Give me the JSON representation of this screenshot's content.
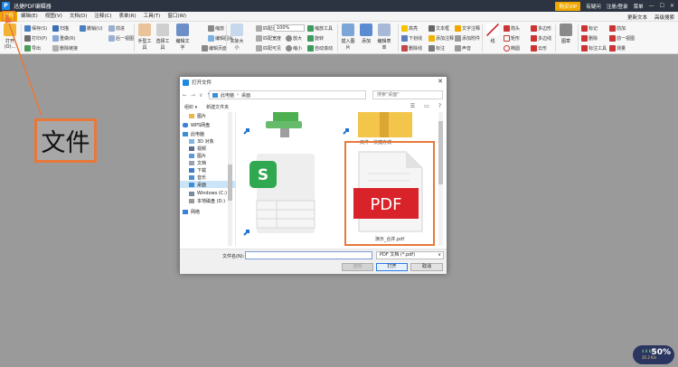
{
  "app": {
    "title": "迅捷PDF编辑器",
    "logo_letter": "P"
  },
  "titlebar": {
    "vip_label": "购买VIP",
    "help_label": "有疑问",
    "login_label": "注册/登录",
    "menu_label": "菜单"
  },
  "menubar": {
    "items": [
      "文件",
      "编辑(E)",
      "视图(V)",
      "文档(D)",
      "注释(C)",
      "表单(R)",
      "工具(T)",
      "窗口(W)"
    ],
    "right": [
      "更新文本",
      "高级搜索"
    ]
  },
  "ribbon": {
    "open_label": "打开(O)...",
    "row1": [
      "保存(S)",
      "扫描",
      "撤销(U)",
      "前进",
      "手型工具",
      "选择工具",
      "编辑文字",
      "缩放",
      "实际大小",
      "匹配页面",
      "缩放工具",
      "插入图片",
      "添加",
      "编辑表单",
      "高亮",
      "文本框",
      "线",
      "箭头",
      "多边形",
      "图章",
      "标记",
      "前加"
    ],
    "row2": [
      "打印(P)",
      "重做(R)",
      "后一视图",
      "编辑图片",
      "匹配宽度",
      "放大",
      "缩小",
      "旋转",
      "编辑内容",
      "添加书签",
      "文字注释",
      "下划线",
      "添加附件",
      "矩形",
      "多边线",
      "删除",
      "前一视图",
      "测量"
    ],
    "row3": [
      "导出",
      "删除链接",
      "编辑页面",
      "匹配可见",
      "自动滚动",
      "添加注释",
      "标注",
      "删除线",
      "声音",
      "椭圆",
      "云形",
      "标注工具"
    ],
    "zoom": "100%"
  },
  "callout": {
    "text": "文件"
  },
  "dialog": {
    "title": "打开文件",
    "nav_arrows": [
      "←",
      "→",
      "∨",
      "↑"
    ],
    "address": [
      "此电脑",
      "桌面"
    ],
    "search_placeholder": "搜索\"桌面\"",
    "cmd": {
      "organize": "组织 ▾",
      "new_folder": "新建文件夹"
    },
    "tree": [
      "图片",
      "WPS网盘",
      "此电脑",
      "3D 对象",
      "视频",
      "图片",
      "文档",
      "下载",
      "音乐",
      "桌面",
      "Windows (C:)",
      "本地磁盘 (D:)",
      "网络"
    ],
    "files": {
      "folder_label": "文件 - 快捷方式",
      "pdf_label": "演示_合并.pdf",
      "pdf_text": "PDF"
    },
    "filename_label": "文件名(N):",
    "filename_value": "",
    "filetype_value": "PDF 文档 (*.pdf)",
    "open_label": "打开",
    "cancel_label": "取消",
    "options_label": "选项"
  },
  "status_badge": {
    "percent": "50%",
    "up": "4.8 K/s",
    "down": "35.2 K/s"
  },
  "colors": {
    "accent": "#f0a800",
    "annotation": "#e8783a",
    "pdf_red": "#d9232a",
    "wps_green": "#2fa84f"
  }
}
